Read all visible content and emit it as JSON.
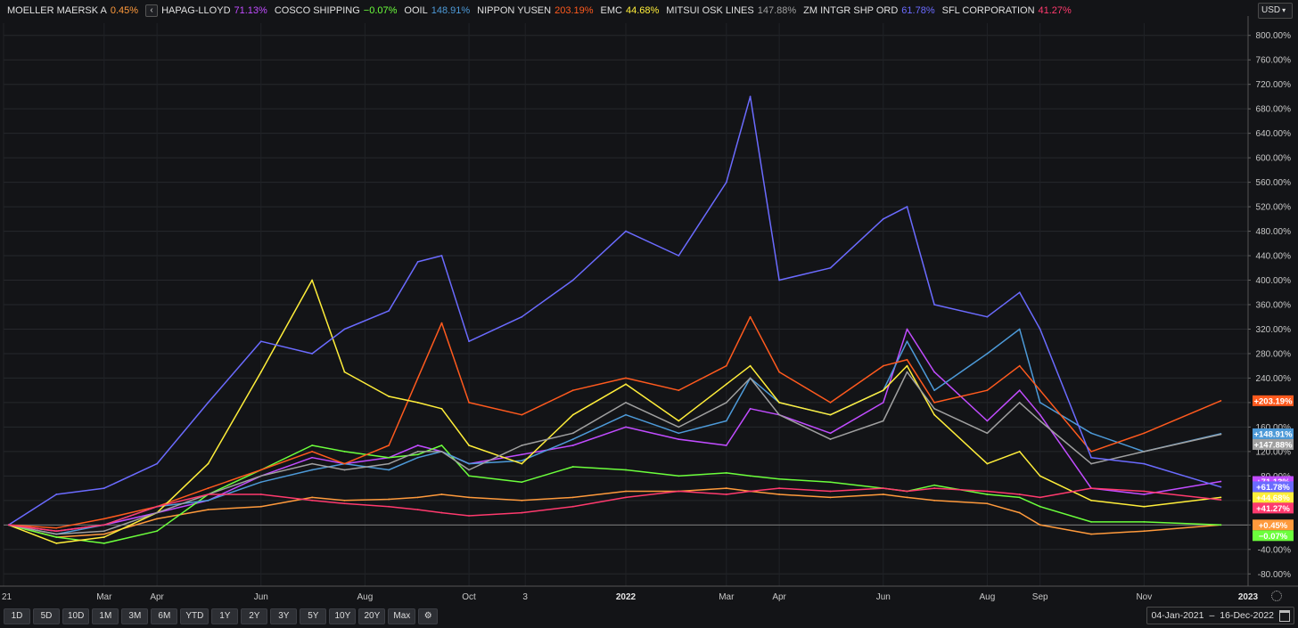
{
  "legend": [
    {
      "name": "MOELLER MAERSK A",
      "value": "0.45%",
      "color": "#ff9a3c"
    },
    {
      "name": "HAPAG-LLOYD",
      "value": "71.13%",
      "color": "#c14cff"
    },
    {
      "name": "COSCO SHIPPING",
      "value": "−0.07%",
      "color": "#6cff3c"
    },
    {
      "name": "OOIL",
      "value": "148.91%",
      "color": "#4d9ad8"
    },
    {
      "name": "NIPPON YUSEN",
      "value": "203.19%",
      "color": "#ff5a1e"
    },
    {
      "name": "EMC",
      "value": "44.68%",
      "color": "#ffee3a"
    },
    {
      "name": "MITSUI OSK LINES",
      "value": "147.88%",
      "color": "#a0a0a0"
    },
    {
      "name": "ZM INTGR SHP ORD",
      "value": "61.78%",
      "color": "#6b6bff"
    },
    {
      "name": "SFL CORPORATION",
      "value": "41.27%",
      "color": "#ff3a6e"
    }
  ],
  "legend_arrow": "‹",
  "currency": "USD",
  "toolbar": [
    "1D",
    "5D",
    "10D",
    "1M",
    "3M",
    "6M",
    "YTD",
    "1Y",
    "2Y",
    "3Y",
    "5Y",
    "10Y",
    "20Y",
    "Max"
  ],
  "date_range": {
    "start": "04-Jan-2021",
    "sep": "–",
    "end": "16-Dec-2022"
  },
  "chart_data": {
    "type": "line",
    "y_ticks": [
      "800.00%",
      "760.00%",
      "720.00%",
      "680.00%",
      "640.00%",
      "600.00%",
      "560.00%",
      "520.00%",
      "480.00%",
      "440.00%",
      "400.00%",
      "360.00%",
      "320.00%",
      "280.00%",
      "240.00%",
      "200.00%",
      "160.00%",
      "120.00%",
      "80.00%",
      "40.00%",
      "0.00%",
      "-40.00%",
      "-80.00%"
    ],
    "ylim": [
      -100,
      820
    ],
    "x_ticks": [
      "21",
      "Mar",
      "Apr",
      "Jun",
      "Aug",
      "Oct",
      "3",
      "2022",
      "Mar",
      "Apr",
      "Jun",
      "Aug",
      "Sep",
      "Nov",
      "2023"
    ],
    "x_tick_dates": [
      "2021-01-01",
      "2021-03-01",
      "2021-04-01",
      "2021-06-01",
      "2021-08-01",
      "2021-10-01",
      "2021-11-03",
      "2022-01-01",
      "2022-03-01",
      "2022-04-01",
      "2022-06-01",
      "2022-08-01",
      "2022-09-01",
      "2022-11-01",
      "2023-01-01"
    ],
    "x": [
      "2021-01-04",
      "2021-02-01",
      "2021-03-01",
      "2021-04-01",
      "2021-05-01",
      "2021-06-01",
      "2021-07-01",
      "2021-07-20",
      "2021-08-15",
      "2021-09-01",
      "2021-09-15",
      "2021-10-01",
      "2021-11-01",
      "2021-12-01",
      "2022-01-01",
      "2022-02-01",
      "2022-03-01",
      "2022-03-15",
      "2022-04-01",
      "2022-05-01",
      "2022-06-01",
      "2022-06-15",
      "2022-07-01",
      "2022-08-01",
      "2022-08-20",
      "2022-09-01",
      "2022-10-01",
      "2022-11-01",
      "2022-12-16"
    ],
    "series": [
      {
        "name": "MOELLER MAERSK A",
        "label": "+0.45%",
        "color": "#ff9a3c",
        "values": [
          0,
          -20,
          -15,
          10,
          25,
          30,
          45,
          40,
          42,
          45,
          50,
          45,
          40,
          45,
          55,
          55,
          60,
          55,
          50,
          45,
          50,
          45,
          40,
          35,
          20,
          0,
          -15,
          -10,
          0
        ]
      },
      {
        "name": "HAPAG-LLOYD",
        "label": "+71.13%",
        "color": "#c14cff",
        "values": [
          0,
          -10,
          0,
          20,
          40,
          80,
          110,
          100,
          110,
          130,
          120,
          100,
          115,
          130,
          160,
          140,
          130,
          190,
          180,
          150,
          200,
          320,
          250,
          170,
          220,
          180,
          60,
          50,
          71
        ]
      },
      {
        "name": "COSCO SHIPPING",
        "label": "−0.07%",
        "color": "#6cff3c",
        "values": [
          0,
          -20,
          -30,
          -10,
          50,
          90,
          130,
          120,
          110,
          115,
          130,
          80,
          70,
          95,
          90,
          80,
          85,
          80,
          75,
          70,
          60,
          55,
          65,
          50,
          45,
          30,
          5,
          5,
          0
        ]
      },
      {
        "name": "OOIL",
        "label": "+148.91%",
        "color": "#4d9ad8",
        "values": [
          0,
          -15,
          0,
          30,
          40,
          70,
          90,
          100,
          90,
          110,
          120,
          100,
          105,
          140,
          180,
          150,
          170,
          240,
          200,
          180,
          220,
          300,
          220,
          280,
          320,
          200,
          150,
          120,
          149
        ]
      },
      {
        "name": "NIPPON YUSEN",
        "label": "+203.19%",
        "color": "#ff5a1e",
        "values": [
          0,
          -5,
          10,
          30,
          60,
          90,
          120,
          100,
          130,
          240,
          330,
          200,
          180,
          220,
          240,
          220,
          260,
          340,
          250,
          200,
          260,
          270,
          200,
          220,
          260,
          220,
          120,
          150,
          203
        ]
      },
      {
        "name": "EMC",
        "label": "+44.68%",
        "color": "#ffee3a",
        "values": [
          0,
          -30,
          -20,
          20,
          100,
          250,
          400,
          250,
          210,
          200,
          190,
          130,
          100,
          180,
          230,
          170,
          230,
          260,
          200,
          180,
          220,
          260,
          180,
          100,
          120,
          80,
          40,
          30,
          45
        ]
      },
      {
        "name": "MITSUI OSK LINES",
        "label": "+147.88%",
        "color": "#a0a0a0",
        "values": [
          0,
          -15,
          -10,
          20,
          50,
          80,
          100,
          90,
          100,
          120,
          120,
          90,
          130,
          150,
          200,
          160,
          200,
          240,
          180,
          140,
          170,
          250,
          190,
          150,
          200,
          170,
          100,
          120,
          148
        ]
      },
      {
        "name": "ZM INTGR SHP ORD",
        "label": "+61.78%",
        "color": "#6b6bff",
        "values": [
          0,
          50,
          60,
          100,
          200,
          300,
          280,
          320,
          350,
          430,
          440,
          300,
          340,
          400,
          480,
          440,
          560,
          700,
          400,
          420,
          500,
          520,
          360,
          340,
          380,
          320,
          110,
          100,
          62
        ]
      },
      {
        "name": "SFL CORPORATION",
        "label": "+41.27%",
        "color": "#ff3a6e",
        "values": [
          0,
          -10,
          0,
          30,
          50,
          50,
          40,
          35,
          30,
          25,
          20,
          15,
          20,
          30,
          45,
          55,
          50,
          55,
          60,
          55,
          60,
          55,
          60,
          55,
          50,
          45,
          60,
          55,
          41
        ]
      }
    ]
  }
}
